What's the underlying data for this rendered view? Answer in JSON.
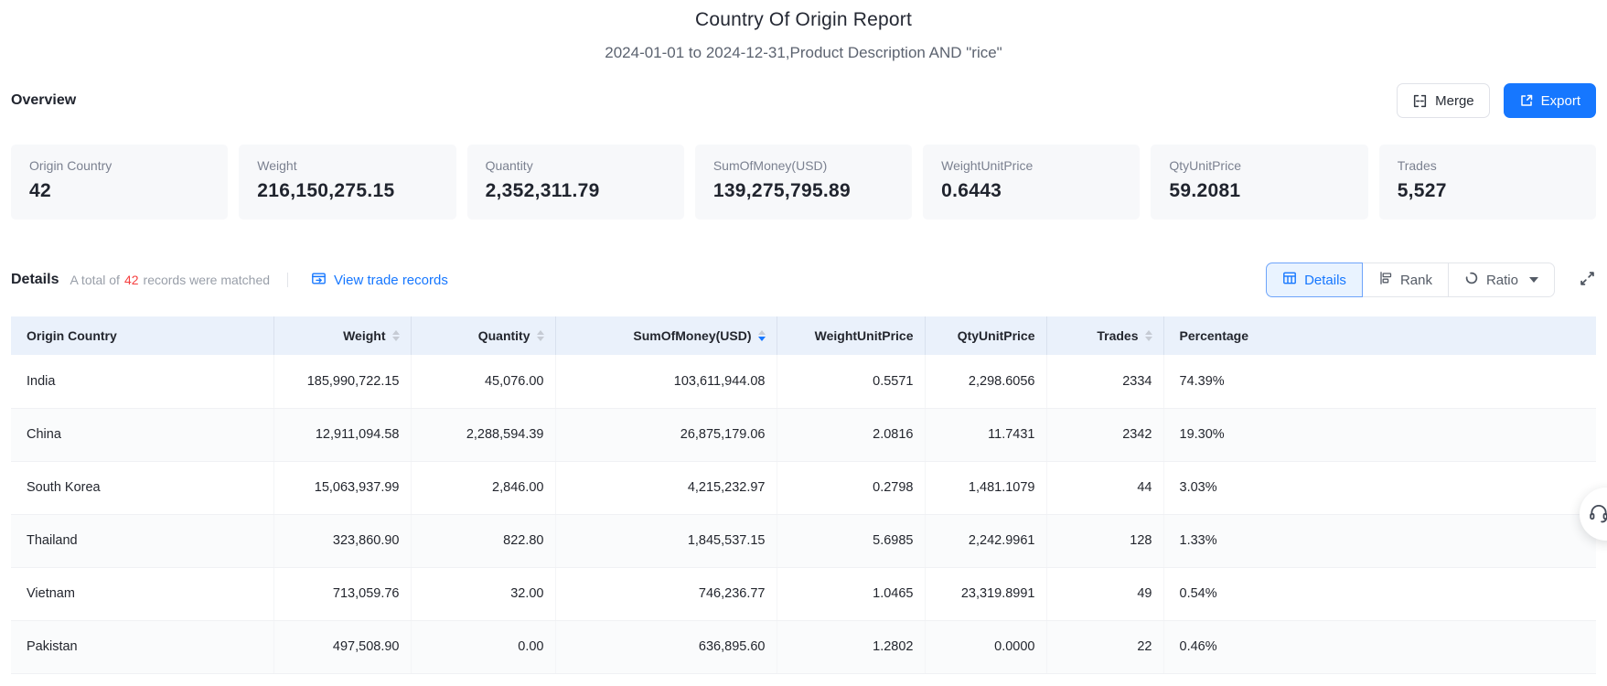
{
  "page": {
    "title": "Country Of Origin Report",
    "subtitle": "2024-01-01 to 2024-12-31,Product Description AND \"rice\""
  },
  "overview": {
    "heading": "Overview",
    "merge_label": "Merge",
    "export_label": "Export",
    "cards": [
      {
        "label": "Origin Country",
        "value": "42"
      },
      {
        "label": "Weight",
        "value": "216,150,275.15"
      },
      {
        "label": "Quantity",
        "value": "2,352,311.79"
      },
      {
        "label": "SumOfMoney(USD)",
        "value": "139,275,795.89"
      },
      {
        "label": "WeightUnitPrice",
        "value": "0.6443"
      },
      {
        "label": "QtyUnitPrice",
        "value": "59.2081"
      },
      {
        "label": "Trades",
        "value": "5,527"
      }
    ]
  },
  "details": {
    "heading": "Details",
    "summary_prefix": "A total of",
    "summary_count": "42",
    "summary_suffix": "records were matched",
    "view_trade_records": "View trade records",
    "tabs": [
      {
        "label": "Details",
        "icon": "table-icon",
        "active": true
      },
      {
        "label": "Rank",
        "icon": "rank-icon",
        "active": false
      },
      {
        "label": "Ratio",
        "icon": "ratio-icon",
        "active": false,
        "has_dropdown": true
      }
    ]
  },
  "table": {
    "columns": [
      {
        "label": "Origin Country",
        "align": "left",
        "sortable": false,
        "sort": null
      },
      {
        "label": "Weight",
        "align": "right",
        "sortable": true,
        "sort": null
      },
      {
        "label": "Quantity",
        "align": "right",
        "sortable": true,
        "sort": null
      },
      {
        "label": "SumOfMoney(USD)",
        "align": "right",
        "sortable": true,
        "sort": "desc"
      },
      {
        "label": "WeightUnitPrice",
        "align": "right",
        "sortable": false,
        "sort": null
      },
      {
        "label": "QtyUnitPrice",
        "align": "right",
        "sortable": false,
        "sort": null
      },
      {
        "label": "Trades",
        "align": "right",
        "sortable": true,
        "sort": null
      },
      {
        "label": "Percentage",
        "align": "left",
        "sortable": false,
        "sort": null
      }
    ],
    "rows": [
      [
        "India",
        "185,990,722.15",
        "45,076.00",
        "103,611,944.08",
        "0.5571",
        "2,298.6056",
        "2334",
        "74.39%"
      ],
      [
        "China",
        "12,911,094.58",
        "2,288,594.39",
        "26,875,179.06",
        "2.0816",
        "11.7431",
        "2342",
        "19.30%"
      ],
      [
        "South Korea",
        "15,063,937.99",
        "2,846.00",
        "4,215,232.97",
        "0.2798",
        "1,481.1079",
        "44",
        "3.03%"
      ],
      [
        "Thailand",
        "323,860.90",
        "822.80",
        "1,845,537.15",
        "5.6985",
        "2,242.9961",
        "128",
        "1.33%"
      ],
      [
        "Vietnam",
        "713,059.76",
        "32.00",
        "746,236.77",
        "1.0465",
        "23,319.8991",
        "49",
        "0.54%"
      ],
      [
        "Pakistan",
        "497,508.90",
        "0.00",
        "636,895.60",
        "1.2802",
        "0.0000",
        "22",
        "0.46%"
      ]
    ]
  },
  "colors": {
    "accent_blue": "#1677ff",
    "count_red": "#f53f3f",
    "table_header_bg": "#eaf1fb",
    "card_bg": "#f7f8fa",
    "active_tab_bg": "#e9f3ff"
  }
}
